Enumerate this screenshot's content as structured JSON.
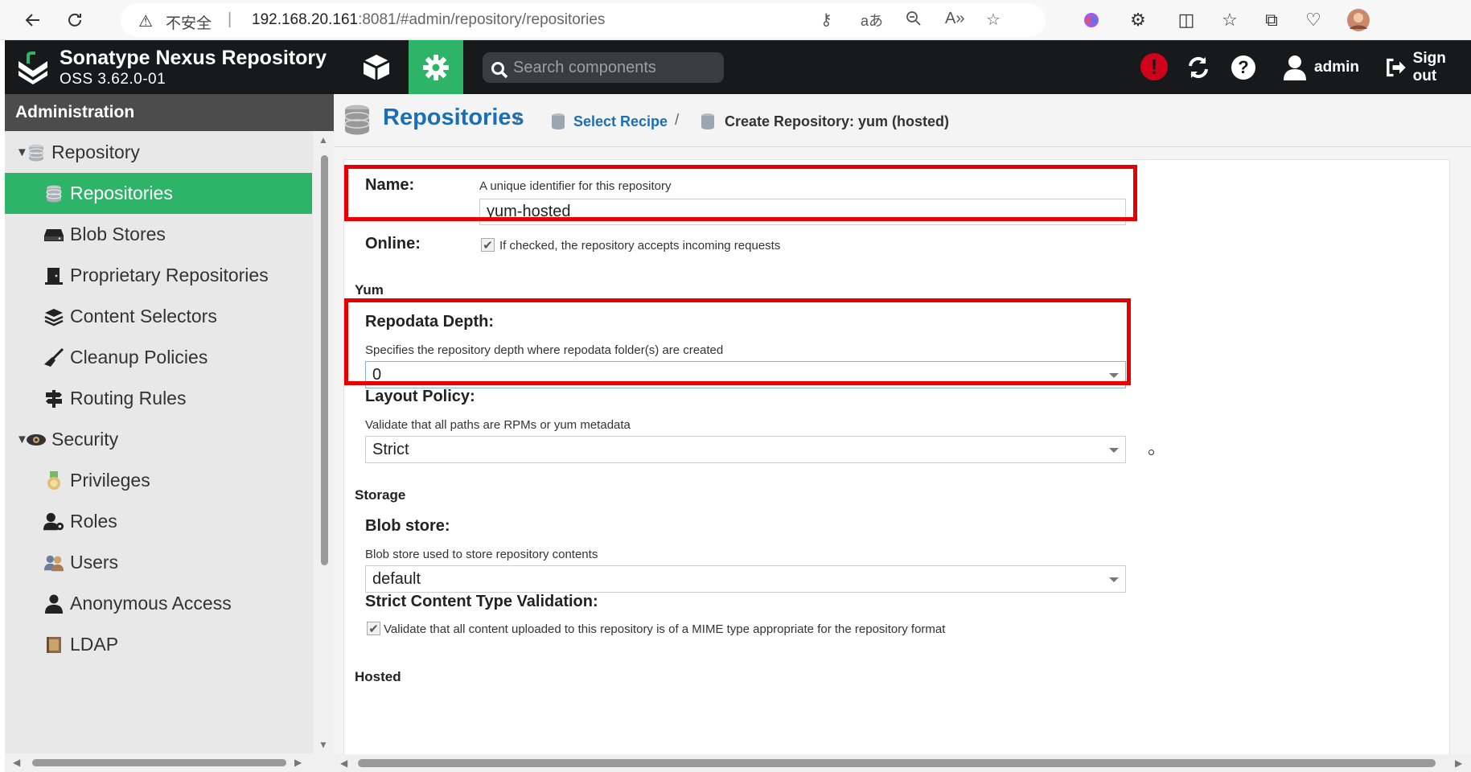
{
  "browser": {
    "insecure_label": "不安全",
    "url_host": "192.168.20.161",
    "url_rest": ":8081/#admin/repository/repositories"
  },
  "header": {
    "product_name": "Sonatype Nexus Repository",
    "version": "OSS 3.62.0-01",
    "search_placeholder": "Search components",
    "alert_glyph": "!",
    "user_label": "admin",
    "signout_label": "Sign out"
  },
  "sidebar": {
    "title": "Administration",
    "items": [
      {
        "label": "Repository",
        "icon": "database-icon",
        "level": 0,
        "expanded": true
      },
      {
        "label": "Repositories",
        "icon": "database-icon",
        "level": 1,
        "active": true
      },
      {
        "label": "Blob Stores",
        "icon": "hard-drive-icon",
        "level": 1
      },
      {
        "label": "Proprietary Repositories",
        "icon": "door-icon",
        "level": 1
      },
      {
        "label": "Content Selectors",
        "icon": "layers-icon",
        "level": 1
      },
      {
        "label": "Cleanup Policies",
        "icon": "broom-icon",
        "level": 1
      },
      {
        "label": "Routing Rules",
        "icon": "signpost-icon",
        "level": 1
      },
      {
        "label": "Security",
        "icon": "eye-icon",
        "level": 0,
        "expanded": true
      },
      {
        "label": "Privileges",
        "icon": "medal-icon",
        "level": 1
      },
      {
        "label": "Roles",
        "icon": "user-gear-icon",
        "level": 1
      },
      {
        "label": "Users",
        "icon": "users-icon",
        "level": 1
      },
      {
        "label": "Anonymous Access",
        "icon": "user-icon",
        "level": 1
      },
      {
        "label": "LDAP",
        "icon": "book-icon",
        "level": 1
      }
    ]
  },
  "breadcrumb": {
    "title": "Repositories",
    "sep": "/",
    "select_recipe": "Select Recipe",
    "current": "Create Repository: yum (hosted)"
  },
  "form": {
    "name": {
      "label": "Name:",
      "help": "A unique identifier for this repository",
      "value": "yum-hosted"
    },
    "online": {
      "label": "Online:",
      "help": "If checked, the repository accepts incoming requests",
      "checked": true
    },
    "yum_section": "Yum",
    "repodata_depth": {
      "label": "Repodata Depth:",
      "help": "Specifies the repository depth where repodata folder(s) are created",
      "value": "0"
    },
    "layout_policy": {
      "label": "Layout Policy:",
      "help": "Validate that all paths are RPMs or yum metadata",
      "value": "Strict"
    },
    "storage_section": "Storage",
    "blob_store": {
      "label": "Blob store:",
      "help": "Blob store used to store repository contents",
      "value": "default"
    },
    "strict_validation": {
      "label": "Strict Content Type Validation:",
      "help": "Validate that all content uploaded to this repository is of a MIME type appropriate for the repository format",
      "checked": true
    },
    "hosted_section": "Hosted"
  },
  "colors": {
    "accent": "#2eb469",
    "header_bg": "#17191a",
    "link": "#1a6fb5",
    "highlight": "#e60000"
  }
}
